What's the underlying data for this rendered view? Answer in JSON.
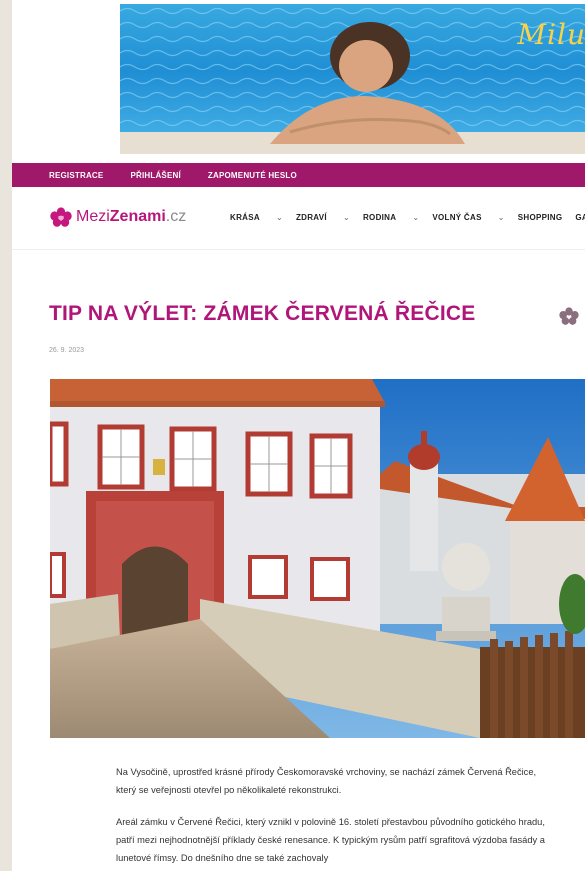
{
  "banner": {
    "brand_text": "Milu"
  },
  "topbar": {
    "links": [
      "REGISTRACE",
      "PŘIHLÁŠENÍ",
      "ZAPOMENUTÉ HESLO"
    ],
    "color": "#a0186a"
  },
  "logo": {
    "prefix": "Mezi",
    "bold": "Zenami",
    "tld": ".cz"
  },
  "menu": {
    "items": [
      {
        "label": "KRÁSA",
        "dropdown": true
      },
      {
        "label": "ZDRAVÍ",
        "dropdown": true
      },
      {
        "label": "RODINA",
        "dropdown": true
      },
      {
        "label": "VOLNÝ ČAS",
        "dropdown": true
      },
      {
        "label": "SHOPPING",
        "dropdown": false
      },
      {
        "label": "GASTR",
        "dropdown": false
      }
    ]
  },
  "article": {
    "title": "TIP NA VÝLET: ZÁMEK ČERVENÁ ŘEČICE",
    "date": "26. 9. 2023",
    "paragraphs": [
      "Na Vysočině, uprostřed krásné přírody Českomoravské vrchoviny, se nachází zámek Červená Řečice, který se veřejnosti otevřel po několikaleté rekonstrukci.",
      "Areál zámku v Červené Řečici, který vznikl v polovině 16. století přestavbou původního gotického hradu, patří mezi nejhodnotnější příklady české renesance. K typickým rysům patří sgrafitová výzdoba fasády a lunetové římsy. Do dnešního dne se také zachovaly"
    ]
  },
  "colors": {
    "accent": "#b01579",
    "page_bg": "#e9e4dc"
  }
}
